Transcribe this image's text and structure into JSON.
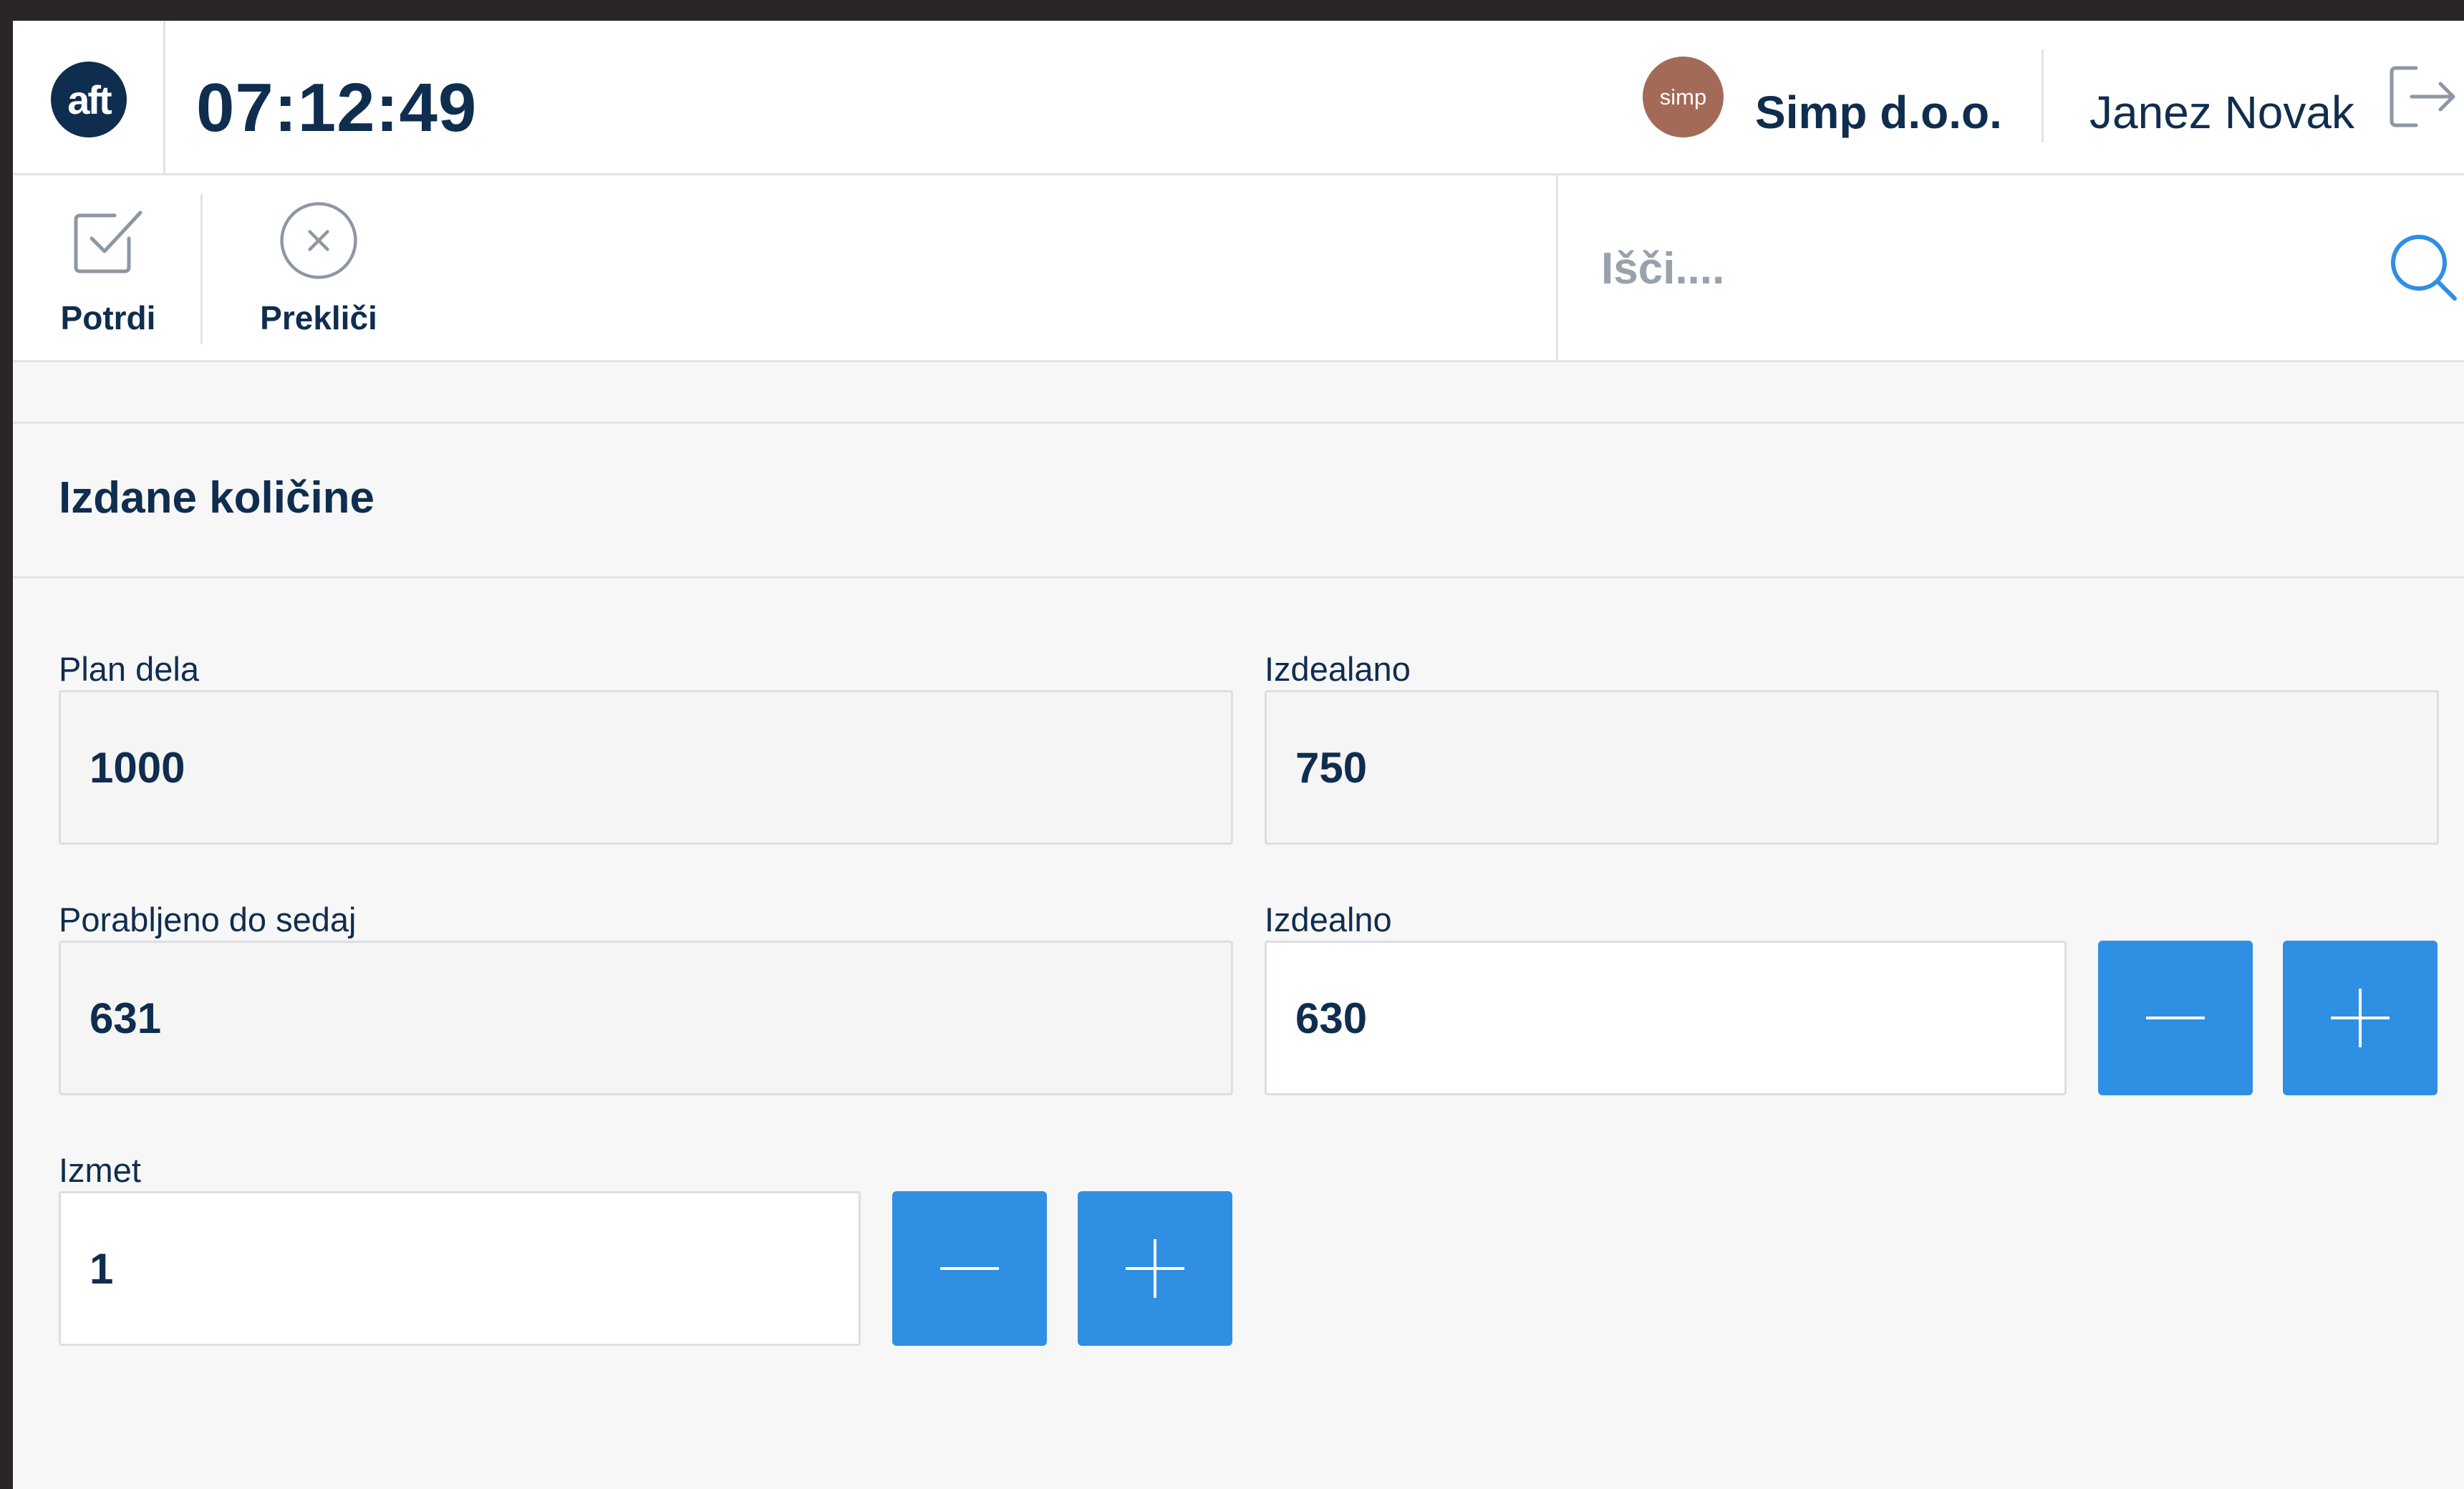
{
  "header": {
    "logo_text": "aft",
    "clock": "07:12:49",
    "company_logo_text": "simp",
    "company_name": "Simp d.o.o.",
    "user_name": "Janez Novak"
  },
  "toolbar": {
    "confirm_label": "Potrdi",
    "cancel_label": "Prekliči",
    "search_placeholder": "Išči...."
  },
  "section": {
    "title": "Izdane količine"
  },
  "fields": {
    "plan_dela": {
      "label": "Plan dela",
      "value": "1000"
    },
    "izdealano": {
      "label": "Izdealano",
      "value": "750"
    },
    "porabljeno": {
      "label": "Porabljeno do sedaj",
      "value": "631"
    },
    "izdealno": {
      "label": "Izdealno",
      "value": "630"
    },
    "izmet": {
      "label": "Izmet",
      "value": "1"
    }
  },
  "colors": {
    "primary": "#2f8fe3",
    "text": "#0f2d4f",
    "logo_bg": "#0f2d4f",
    "company_avatar": "#a36a58"
  }
}
